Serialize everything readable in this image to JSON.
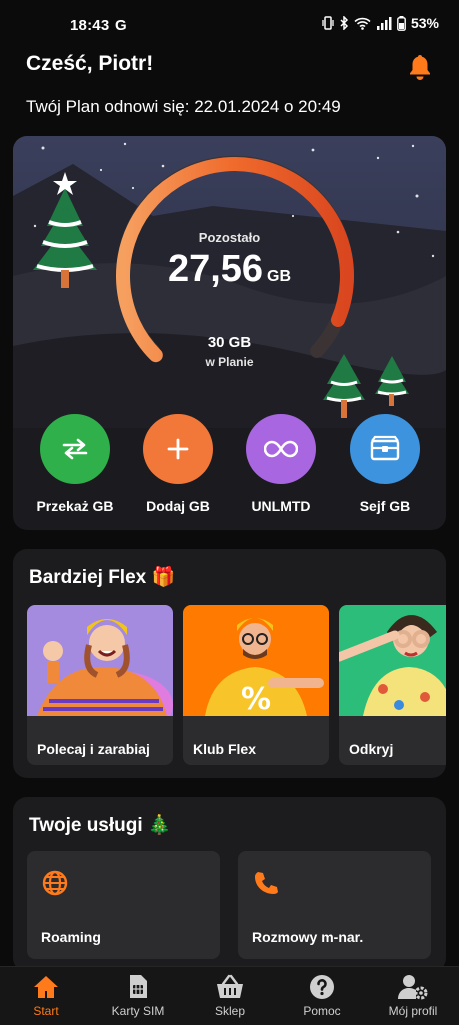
{
  "status_bar": {
    "time": "18:43",
    "carrier_icon": "G",
    "battery": "53%"
  },
  "header": {
    "greeting": "Cześć, Piotr!",
    "plan_renewal": "Twój Plan odnowi się: 22.01.2024 o 20:49"
  },
  "data_usage": {
    "remaining_label": "Pozostało",
    "remaining_value": "27,56",
    "remaining_unit": "GB",
    "plan_size": "30 GB",
    "plan_caption": "w Planie",
    "remaining_fraction": 0.919
  },
  "actions": [
    {
      "label": "Przekaż GB",
      "icon": "transfer-icon",
      "color": "#2fb04a"
    },
    {
      "label": "Dodaj GB",
      "icon": "plus-icon",
      "color": "#f2783a"
    },
    {
      "label": "UNLMTD",
      "icon": "infinity-icon",
      "color": "#a867e0"
    },
    {
      "label": "Sejf GB",
      "icon": "vault-icon",
      "color": "#3d93de"
    }
  ],
  "flex": {
    "title": "Bardziej Flex 🎁",
    "cards": [
      {
        "label": "Polecaj i zarabiaj",
        "bg": "#a58be0"
      },
      {
        "label": "Klub Flex",
        "bg": "#ff7a00"
      },
      {
        "label": "Odkryj",
        "bg": "#2dbd7a"
      }
    ]
  },
  "services": {
    "title": "Twoje usługi 🎄",
    "cards": [
      {
        "label": "Roaming",
        "icon": "globe-icon"
      },
      {
        "label": "Rozmowy m-nar.",
        "icon": "phone-icon"
      }
    ]
  },
  "nav": {
    "items": [
      {
        "label": "Start",
        "icon": "home-icon",
        "active": true
      },
      {
        "label": "Karty SIM",
        "icon": "sim-card-icon"
      },
      {
        "label": "Sklep",
        "icon": "basket-icon"
      },
      {
        "label": "Pomoc",
        "icon": "help-icon"
      },
      {
        "label": "Mój profil",
        "icon": "profile-settings-icon"
      }
    ]
  },
  "colors": {
    "accent": "#ff7a1a",
    "background": "#0b0b0b",
    "card": "#1c1c1e"
  }
}
